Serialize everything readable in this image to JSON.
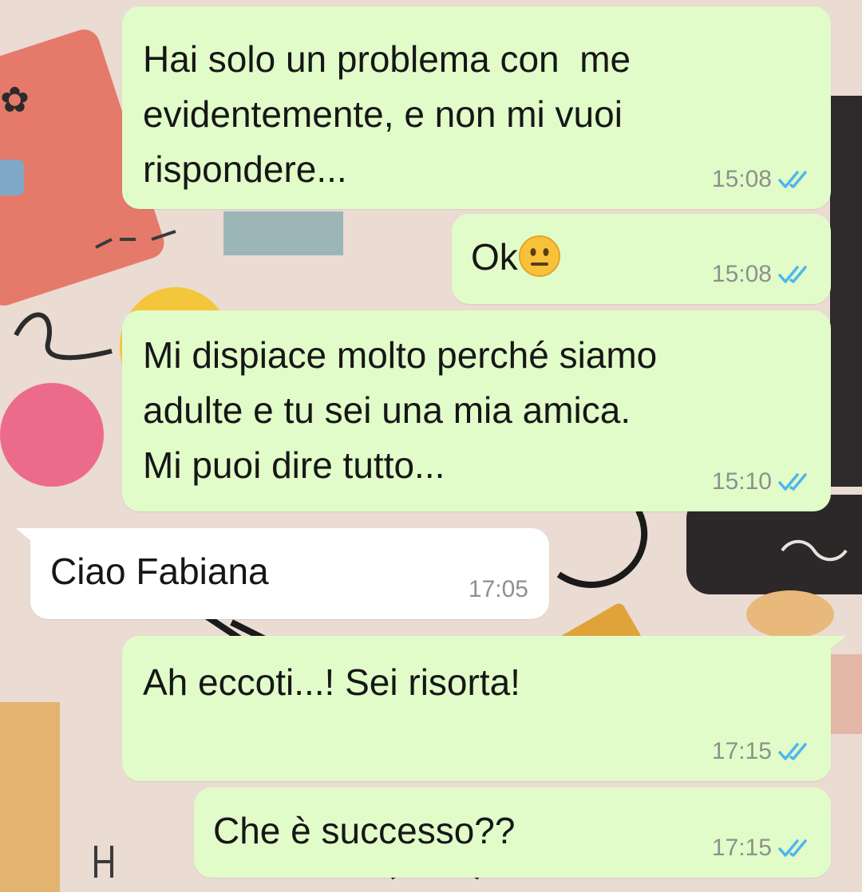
{
  "chat": {
    "messages": [
      {
        "direction": "outgoing",
        "lines": [
          "Hai solo un problema con  me",
          "evidentemente, e non mi vuoi",
          "rispondere..."
        ],
        "time": "15:08",
        "status": "read"
      },
      {
        "direction": "outgoing",
        "text": "Ok",
        "emoji": "neutral-face",
        "time": "15:08",
        "status": "read"
      },
      {
        "direction": "outgoing",
        "lines": [
          "Mi dispiace molto perché siamo",
          "adulte e tu sei una mia amica.",
          "Mi puoi dire tutto..."
        ],
        "time": "15:10",
        "status": "read"
      },
      {
        "direction": "incoming",
        "text": "Ciao Fabiana",
        "time": "17:05"
      },
      {
        "direction": "outgoing",
        "text": "Ah eccoti...! Sei risorta!",
        "time": "17:15",
        "status": "read"
      },
      {
        "direction": "outgoing",
        "text": "Che è successo??",
        "time": "17:15",
        "status": "read"
      }
    ]
  },
  "colors": {
    "outgoing_bubble": "#e1fcc9",
    "incoming_bubble": "#ffffff",
    "read_ticks": "#4fb6ec",
    "timestamp": "#8d918c"
  }
}
